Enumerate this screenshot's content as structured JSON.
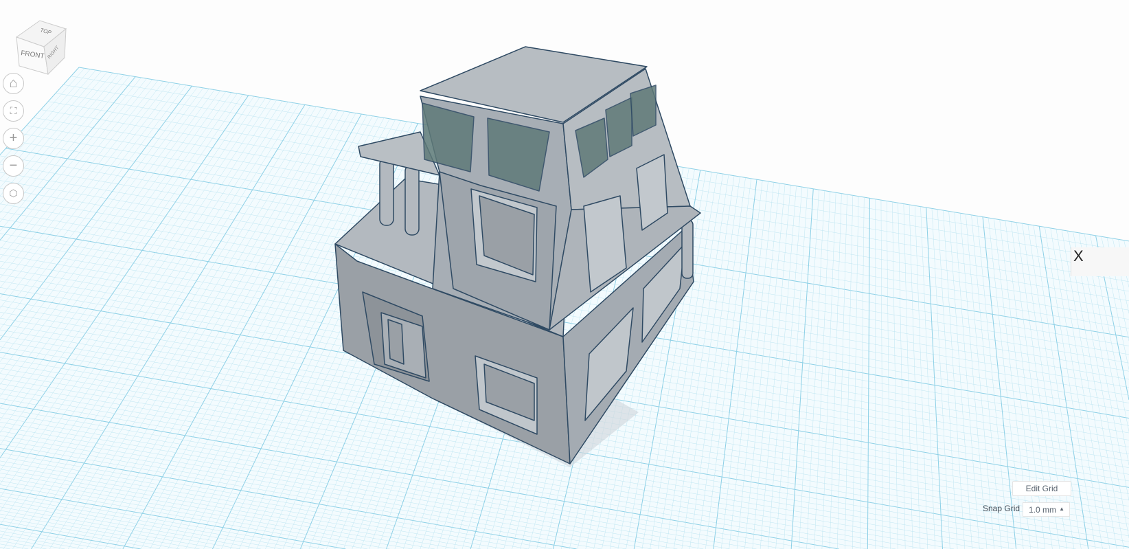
{
  "viewcube": {
    "top": "TOP",
    "front": "FRONT",
    "right": "RIGHT"
  },
  "nav": [
    {
      "name": "home-view",
      "icon": "home-icon"
    },
    {
      "name": "fit-view",
      "icon": "fit-all-icon"
    },
    {
      "name": "zoom-in",
      "icon": "plus-icon"
    },
    {
      "name": "zoom-out",
      "icon": "minus-icon"
    },
    {
      "name": "perspective-toggle",
      "icon": "cube-icon"
    }
  ],
  "grid": {
    "edit_label": "Edit Grid",
    "snap_label": "Snap Grid",
    "snap_value": "1.0 mm"
  },
  "side_panel": {
    "label": "X"
  },
  "colors": {
    "grid_minor": "#bfe6f2",
    "grid_major": "#8dd0e6",
    "model_fill": "#a9b0b7",
    "model_edge": "#2f4a63",
    "glass": "#5f7a78"
  }
}
